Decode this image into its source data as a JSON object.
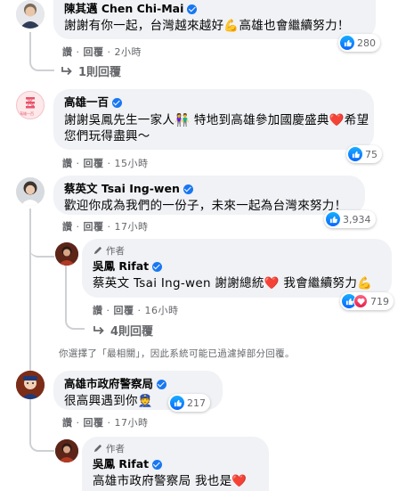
{
  "comments": [
    {
      "name": "陳其邁 Chen Chi-Mai",
      "text": "謝謝有你一起，台灣越來越好💪高雄也會繼續努力！",
      "actions": {
        "like": "讚",
        "reply": "回覆",
        "time": "2小時"
      },
      "reactions": "280",
      "replies_link": "1則回覆"
    },
    {
      "name": "高雄一百",
      "avatar_text": "高雄一百",
      "text_line1": "謝謝吳鳳先生一家人👫 特地到高雄參加國慶盛典❤️希望",
      "text_line2": "您們玩得盡興～",
      "actions": {
        "like": "讚",
        "reply": "回覆",
        "time": "15小時"
      },
      "reactions": "75"
    },
    {
      "name": "蔡英文 Tsai Ing-wen",
      "text": "歡迎你成為我們的一份子，未來一起為台灣來努力！",
      "actions": {
        "like": "讚",
        "reply": "回覆",
        "time": "17小時"
      },
      "reactions": "3,934",
      "reply": {
        "author_label": "作者",
        "name": "吳鳳 Rifat",
        "text": "蔡英文 Tsai Ing-wen 謝謝總統❤️ 我會繼續努力💪",
        "actions": {
          "like": "讚",
          "reply": "回覆",
          "time": "16小時"
        },
        "reactions": "719"
      },
      "replies_link": "4則回覆"
    },
    {
      "filter_note": "你選擇了「最相關」，因此系統可能已過濾掉部分回覆。"
    },
    {
      "name": "高雄市政府警察局",
      "text": "很高興遇到你👮",
      "actions": {
        "like": "讚",
        "reply": "回覆",
        "time": "17小時"
      },
      "reactions": "217",
      "reply": {
        "author_label": "作者",
        "name": "吳鳳 Rifat",
        "text": "高雄市政府警察局 我也是❤️"
      }
    }
  ],
  "colors": {
    "bubble": "#f0f2f5",
    "secondary_text": "#65676b",
    "like_blue": "#1877f2",
    "heart_red": "#e61e4d",
    "thread_line": "#ced0d4"
  },
  "icons": [
    "verified-badge-icon",
    "like-reaction-icon",
    "love-reaction-icon",
    "reply-arrow-icon",
    "pen-author-icon"
  ]
}
